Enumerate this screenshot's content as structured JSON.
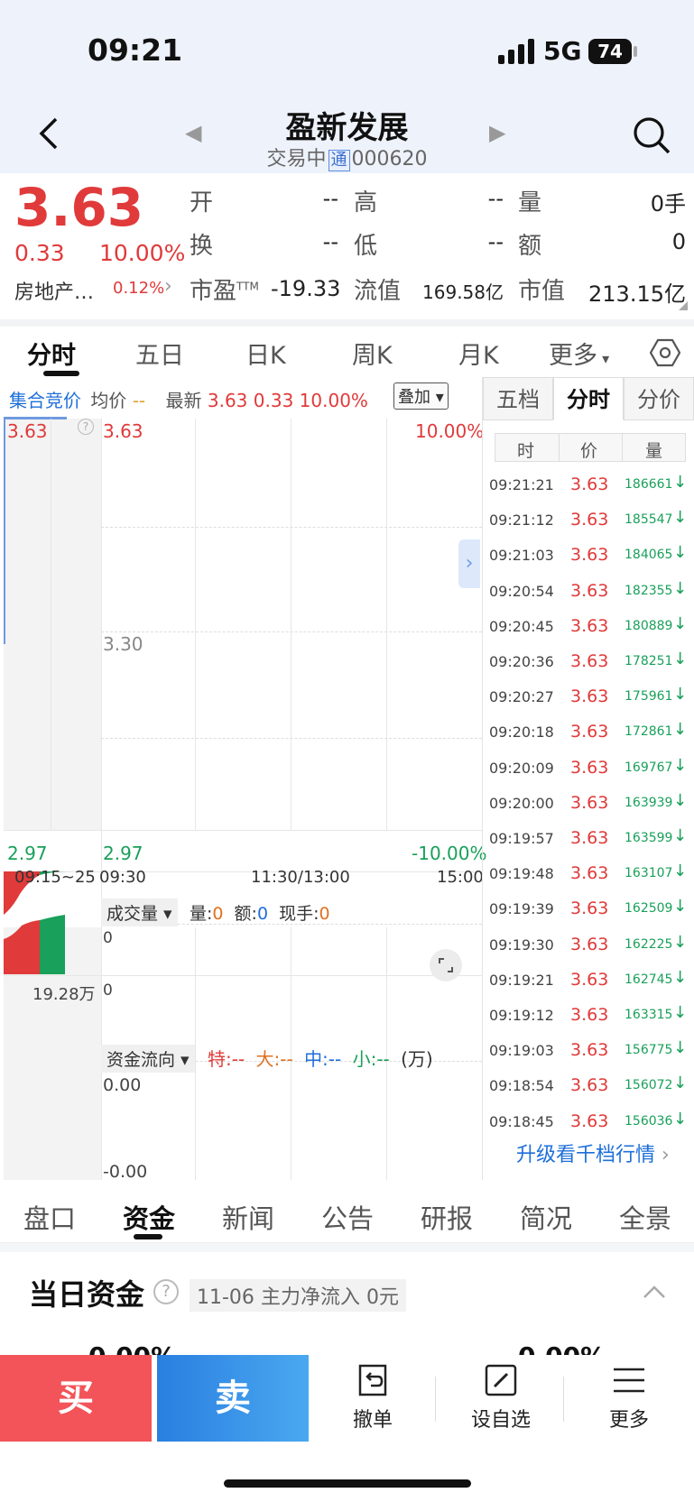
{
  "status": {
    "time": "09:21",
    "network": "5G",
    "battery": "74"
  },
  "header": {
    "name": "盈新发展",
    "status": "交易中",
    "badge": "通",
    "code": "000620"
  },
  "quote": {
    "price": "3.63",
    "change": "0.33",
    "change_pct": "10.00%",
    "sector": "房地产…",
    "sector_pct": "0.12%",
    "fields": [
      {
        "label": "开",
        "value": "--"
      },
      {
        "label": "高",
        "value": "--"
      },
      {
        "label": "量",
        "value": "0手"
      },
      {
        "label": "换",
        "value": "--"
      },
      {
        "label": "低",
        "value": "--"
      },
      {
        "label": "额",
        "value": "0"
      },
      {
        "label": "市盈",
        "sup": "TTM",
        "value": "-19.33"
      },
      {
        "label": "流值",
        "value": "169.58亿"
      },
      {
        "label": "市值",
        "value": "213.15亿"
      }
    ]
  },
  "tabs": [
    "分时",
    "五日",
    "日K",
    "周K",
    "月K",
    "更多"
  ],
  "chart": {
    "info": {
      "auction": "集合竞价",
      "avg_label": "均价",
      "avg_value": "--",
      "latest_label": "最新",
      "latest_price": "3.63",
      "latest_chg": "0.33",
      "latest_pct": "10.00%",
      "overlay": "叠加"
    },
    "auction_top": "3.63",
    "auction_bottom": "2.97",
    "y_top": "3.63",
    "y_mid": "3.30",
    "y_bottom": "2.97",
    "pct_top": "10.00%",
    "pct_bottom": "-10.00%",
    "x_ticks": [
      "09:15~25",
      "09:30",
      "11:30/13:00",
      "15:00"
    ],
    "volume": {
      "selector": "成交量",
      "vol_label": "量:",
      "vol": "0",
      "amt_label": "额:",
      "amt": "0",
      "hand_label": "现手:",
      "hand": "0",
      "axis_top": "0",
      "axis_mid": "0",
      "auction_vol": "19.28万"
    },
    "flow": {
      "selector": "资金流向",
      "te": "特:--",
      "da": "大:--",
      "zhong": "中:--",
      "xiao": "小:--",
      "unit": "(万)",
      "axis_top": "0.00",
      "axis_bottom": "-0.00"
    }
  },
  "right_panel": {
    "tabs": [
      "五档",
      "分时",
      "分价"
    ],
    "headers": [
      "时",
      "价",
      "量"
    ],
    "ticks": [
      {
        "time": "09:21:21",
        "price": "3.63",
        "vol": "186661"
      },
      {
        "time": "09:21:12",
        "price": "3.63",
        "vol": "185547"
      },
      {
        "time": "09:21:03",
        "price": "3.63",
        "vol": "184065"
      },
      {
        "time": "09:20:54",
        "price": "3.63",
        "vol": "182355"
      },
      {
        "time": "09:20:45",
        "price": "3.63",
        "vol": "180889"
      },
      {
        "time": "09:20:36",
        "price": "3.63",
        "vol": "178251"
      },
      {
        "time": "09:20:27",
        "price": "3.63",
        "vol": "175961"
      },
      {
        "time": "09:20:18",
        "price": "3.63",
        "vol": "172861"
      },
      {
        "time": "09:20:09",
        "price": "3.63",
        "vol": "169767"
      },
      {
        "time": "09:20:00",
        "price": "3.63",
        "vol": "163939"
      },
      {
        "time": "09:19:57",
        "price": "3.63",
        "vol": "163599"
      },
      {
        "time": "09:19:48",
        "price": "3.63",
        "vol": "163107"
      },
      {
        "time": "09:19:39",
        "price": "3.63",
        "vol": "162509"
      },
      {
        "time": "09:19:30",
        "price": "3.63",
        "vol": "162225"
      },
      {
        "time": "09:19:21",
        "price": "3.63",
        "vol": "162745"
      },
      {
        "time": "09:19:12",
        "price": "3.63",
        "vol": "163315"
      },
      {
        "time": "09:19:03",
        "price": "3.63",
        "vol": "156775"
      },
      {
        "time": "09:18:54",
        "price": "3.63",
        "vol": "156072"
      },
      {
        "time": "09:18:45",
        "price": "3.63",
        "vol": "156036"
      }
    ],
    "arrow": "↓",
    "upgrade": "升级看千档行情"
  },
  "bottom_tabs": [
    "盘口",
    "资金",
    "新闻",
    "公告",
    "研报",
    "简况",
    "全景"
  ],
  "funds": {
    "title": "当日资金",
    "date": "11-06",
    "text": "主力净流入",
    "value": "0元",
    "peek_left": "0.00%",
    "peek_right": "0.00%"
  },
  "actions": {
    "buy": "买",
    "sell": "卖",
    "cancel": "撤单",
    "watch": "设自选",
    "more": "更多"
  },
  "colors": {
    "up": "#e03a3a",
    "down": "#19a05a",
    "accent": "#1e6fd9"
  }
}
